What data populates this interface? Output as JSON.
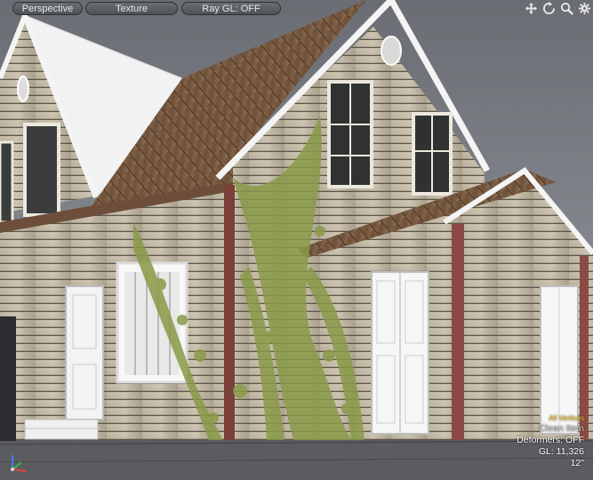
{
  "toolbar": {
    "view_mode": "Perspective",
    "shading_mode": "Texture",
    "ray_gl": "Ray GL: OFF"
  },
  "toolbar_icons": [
    "move-icon",
    "rotate-icon",
    "zoom-icon",
    "settings-icon"
  ],
  "hud": {
    "flag": "All Vertices",
    "mesh_name": "Clean Item",
    "deformers": "Deformers: OFF",
    "gl_count": "GL: 11,326",
    "grid_size": "12\""
  },
  "colors": {
    "toolbar_pill": "#5b5e63",
    "background": "#8a8d93",
    "roof": "#7a5a40",
    "wall": "#c4bca9",
    "ivy": "#8a9a48",
    "trim": "#f2f2f2",
    "hud_flag": "#ffcc22"
  }
}
